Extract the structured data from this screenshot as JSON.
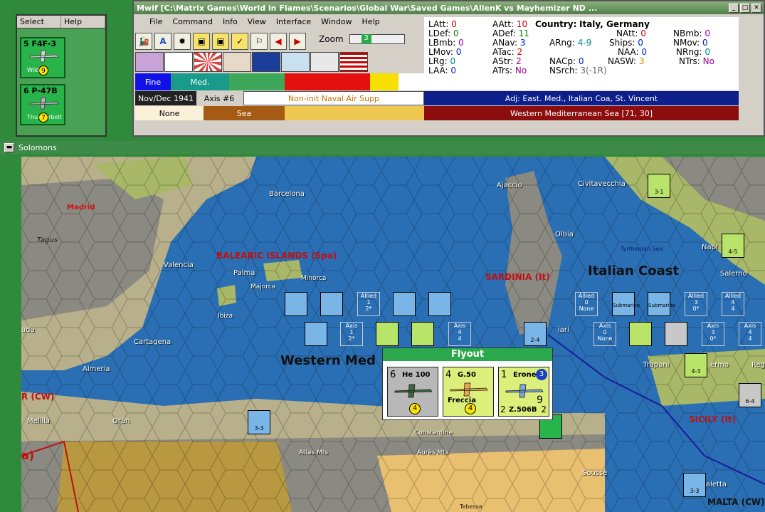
{
  "select_panel": {
    "tabs": [
      "Select",
      "Help"
    ],
    "units": [
      {
        "top": "5  F4F-3",
        "name": "Wildcat",
        "value": "9"
      },
      {
        "top": "6  P-47B",
        "name": "Thunderbolt",
        "value": "7"
      }
    ]
  },
  "main_window": {
    "title": "Mwif [C:\\Matrix Games\\World in Flames\\Scenarios\\Global War\\Saved Games\\AllenK vs Mayhemizer ND ...",
    "menu": [
      "File",
      "Command",
      "Info",
      "View",
      "Interface",
      "Window",
      "Help"
    ],
    "zoom_label": "Zoom",
    "zoom_value": "3",
    "weather": [
      "Fine",
      "Med."
    ],
    "date": "Nov/Dec 1941",
    "axis_turn": "Axis #6",
    "status": "Non-init Naval Air Supp",
    "terrain": [
      "None",
      "Sea"
    ],
    "adjacent": "Adj: East. Med., Italian Coa, St. Vincent",
    "sea_area": "Western Mediterranean Sea [71, 30]"
  },
  "stats": {
    "country_label": "Country:",
    "country": "Italy, Germany",
    "LAtt": "0",
    "LDef": "0",
    "LBmb": "0",
    "LMov": "0",
    "LRg": "0",
    "LAA": "0",
    "AAtt": "10",
    "ADef": "11",
    "ANav": "3",
    "ATac": "2",
    "AStr": "2",
    "ATrs": "No",
    "ARng": "4-9",
    "NACp": "0",
    "NSrch": "3(-1R)",
    "NAtt": "0",
    "Ships": "0",
    "NAA": "0",
    "NASW": "3",
    "NBmb": "0",
    "NMov": "0",
    "NRng": "0",
    "NTrs": "No"
  },
  "map_window": {
    "title": "Solomons",
    "sea_labels": [
      "Western Med",
      "Italian Coast"
    ],
    "region_labels": [
      "BALEARIC ISLANDS (Spa)",
      "SARDINIA (It)",
      "SICILY (It)",
      "MALTA (CW)",
      "R (CW)"
    ],
    "cities": [
      "Barcelona",
      "Madrid",
      "Tagus",
      "Valencia",
      "Palma",
      "Majorca",
      "Minorca",
      "Ibiza",
      "Cartagena",
      "Almeria",
      "Melilla",
      "Oran",
      "Constantine",
      "Atlas Mts",
      "Aurès Mts",
      "Ajaccio",
      "Civitavecchia",
      "Olbia",
      "Tyrrhenian Sea",
      "Napl",
      "Salerno",
      "Trapani",
      "ermo",
      "Reg",
      "Sousse",
      "aletta",
      "Tebessa",
      "iari",
      "ada",
      "a)"
    ],
    "counters": [
      "Allied",
      "1",
      "2*",
      "Axis",
      "0",
      "None",
      "3",
      "0*",
      "4",
      "Submarine",
      "3-1",
      "4-5",
      "4-3",
      "6-4",
      "2-4",
      "3-3"
    ]
  },
  "flyout": {
    "title": "Flyout",
    "cards": [
      {
        "num": "6",
        "name": "He 100",
        "bottom": "4",
        "color": "#b8b8b8"
      },
      {
        "num": "4",
        "name": "G.50",
        "sub": "Freccia",
        "bottom": "4",
        "color": "#dcef7a"
      },
      {
        "num": "1",
        "name": "Erone",
        "sub": "Z.506B",
        "bottom": "9",
        "extra_left": "2",
        "extra_right": "2",
        "badge": "3",
        "color": "#dcef7a"
      }
    ]
  }
}
